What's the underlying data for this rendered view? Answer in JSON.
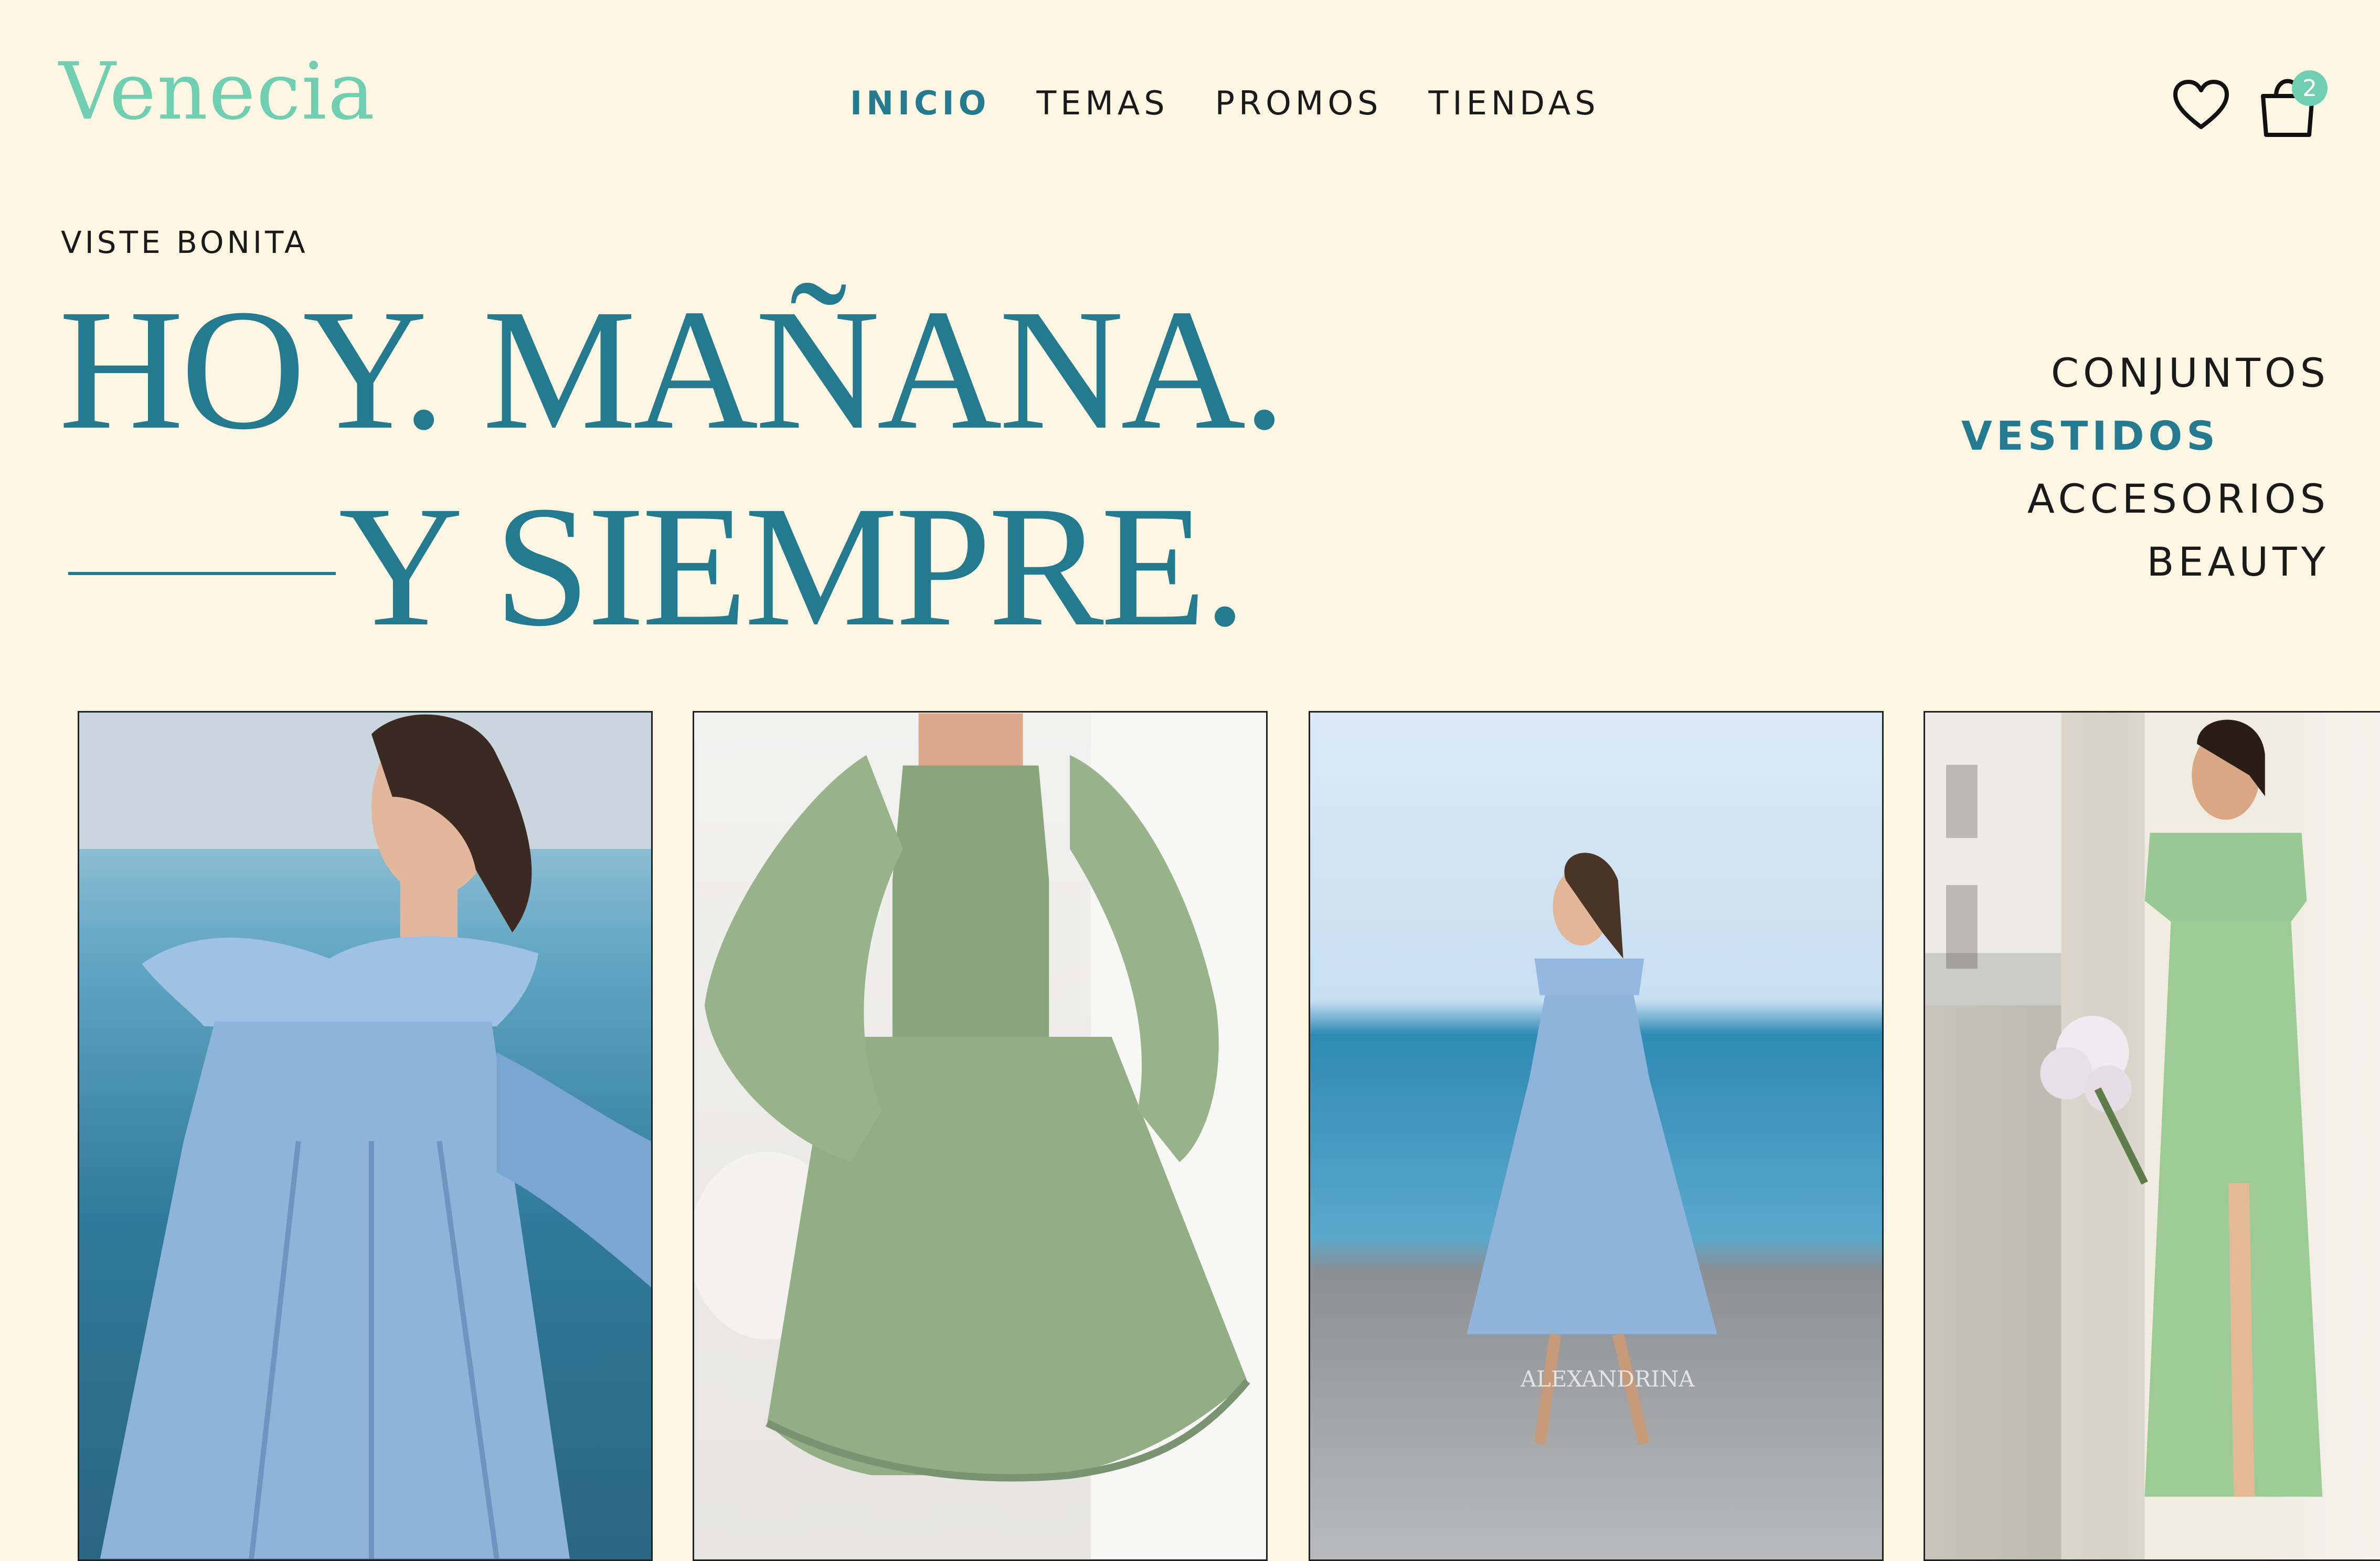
{
  "brand": {
    "logo": "Venecia"
  },
  "nav": {
    "items": [
      {
        "label": "INICIO",
        "active": true
      },
      {
        "label": "TEMAS",
        "active": false
      },
      {
        "label": "PROMOS",
        "active": false
      },
      {
        "label": "TIENDAS",
        "active": false
      }
    ]
  },
  "header": {
    "cart_count": "2"
  },
  "hero": {
    "kicker": "VISTE BONITA",
    "line1": "HOY. MAÑANA.",
    "line2": "Y SIEMPRE."
  },
  "categories": [
    {
      "label": "CONJUNTOS",
      "active": false
    },
    {
      "label": "VESTIDOS",
      "active": true
    },
    {
      "label": "ACCESORIOS",
      "active": false
    },
    {
      "label": "BEAUTY",
      "active": false
    }
  ],
  "products": [
    {
      "color": "#8fb4dc",
      "alt": "blue off-shoulder gown"
    },
    {
      "color": "#93ad85",
      "alt": "green smocked ruffle dress"
    },
    {
      "color": "#8fb4dc",
      "alt": "blue off-shoulder midi dress"
    },
    {
      "color": "#9ccb96",
      "alt": "green floral slit dress"
    }
  ],
  "watermark": "ALEXANDRINA",
  "colors": {
    "accent": "#247b90",
    "logo": "#6fcfb0",
    "background": "#fdf6e3"
  }
}
